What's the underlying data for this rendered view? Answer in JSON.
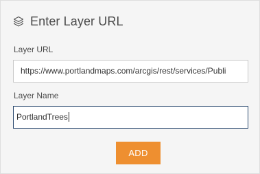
{
  "panel": {
    "title": "Enter Layer URL",
    "icon": "layers-icon"
  },
  "url_field": {
    "label": "Layer URL",
    "value": "https://www.portlandmaps.com/arcgis/rest/services/Publi"
  },
  "name_field": {
    "label": "Layer Name",
    "value": "PortlandTrees"
  },
  "add_button": {
    "label": "ADD",
    "color": "#ee8f30"
  },
  "colors": {
    "panel_background": "#f5f5f5",
    "focus_border": "#2b4a6f"
  }
}
